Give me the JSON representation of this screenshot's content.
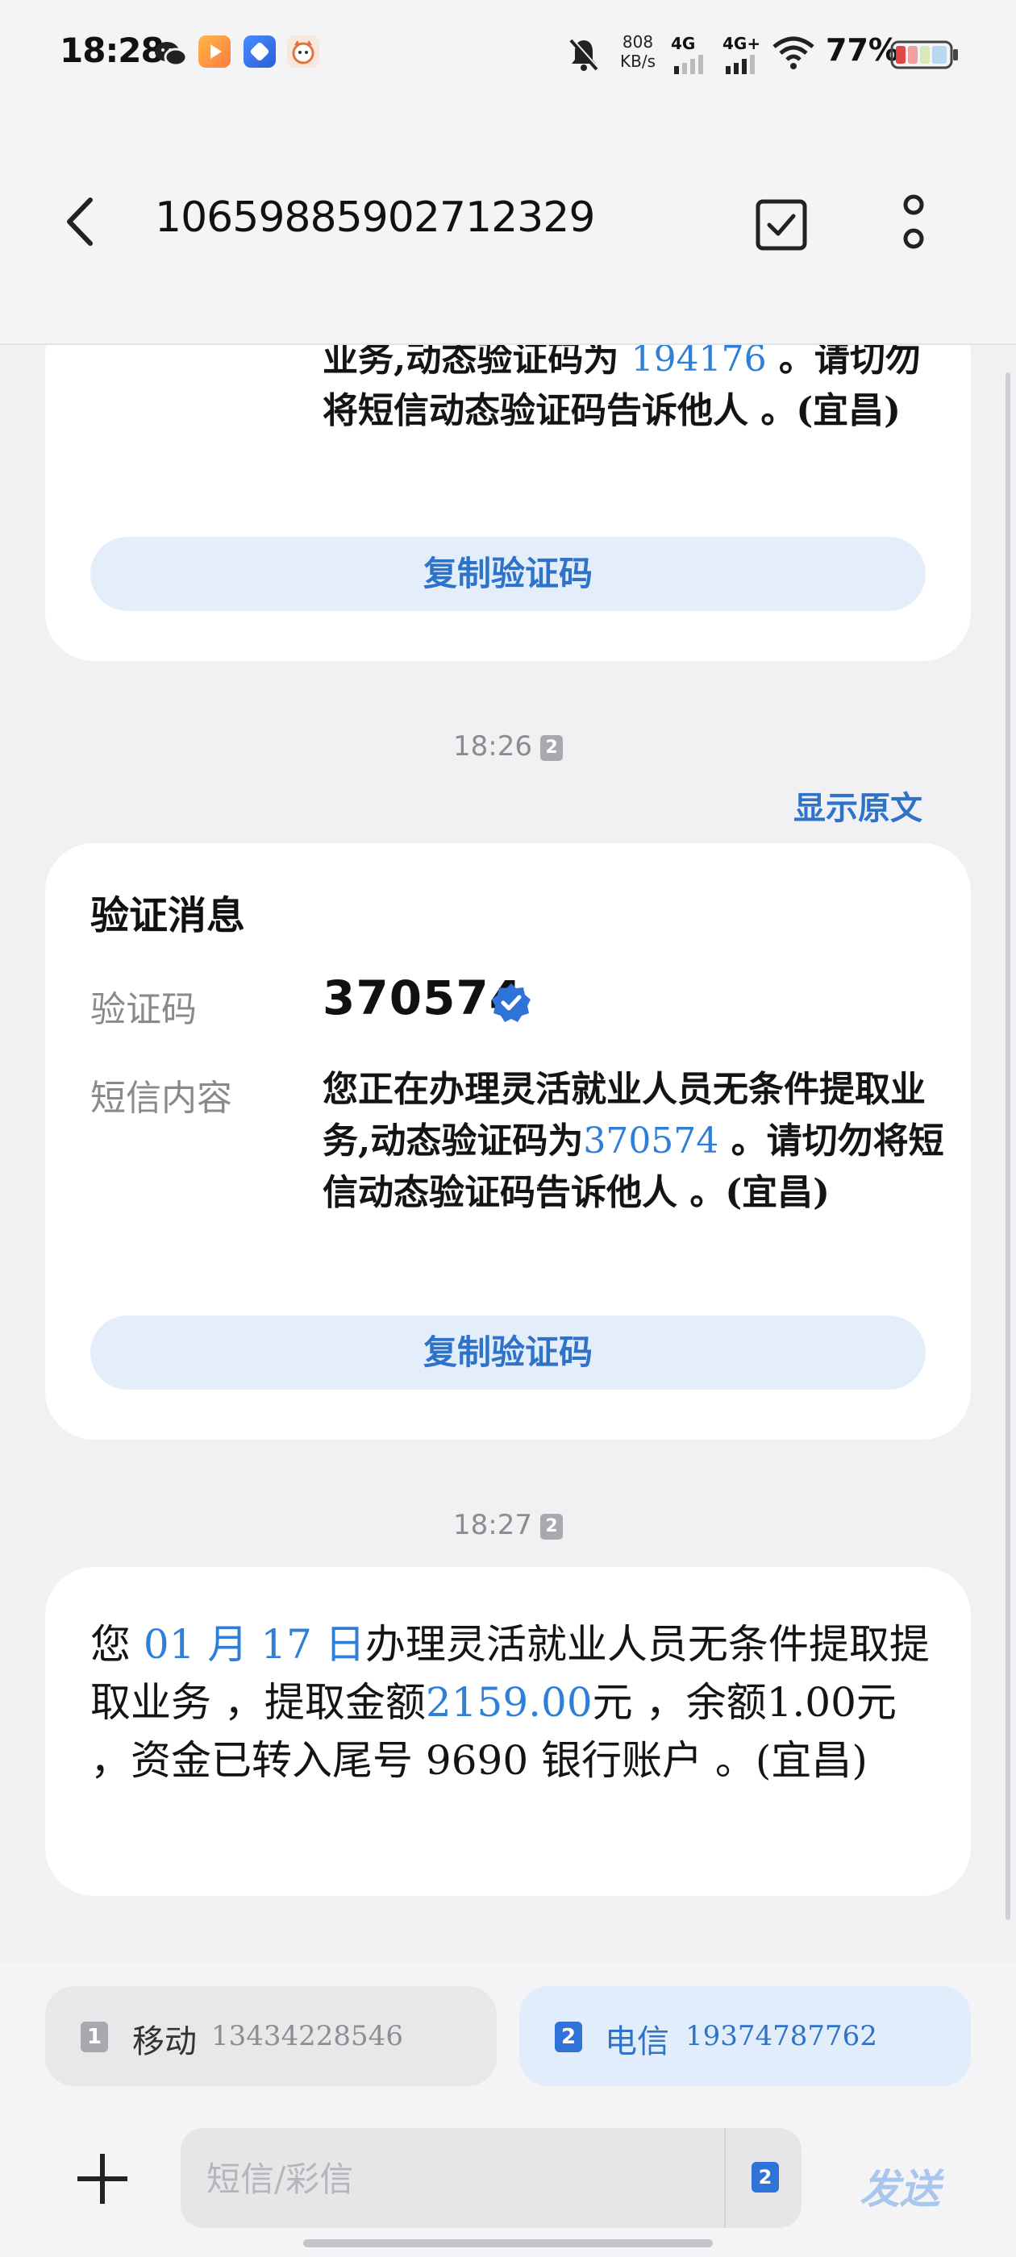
{
  "status_bar": {
    "time": "18:28",
    "network_speed_value": "808",
    "network_speed_unit": "KB/s",
    "sim1_type": "4G",
    "sim2_type": "4G+",
    "battery": "77%",
    "app_icons": [
      "wechat-icon",
      "video-app-icon",
      "blue-app-icon",
      "cat-app-icon"
    ]
  },
  "header": {
    "title": "10659885902712329"
  },
  "messages": {
    "first": {
      "text_before": "业务,动态验证码为 ",
      "code": "194176",
      "text_after": " 。请切勿将短信动态验证码告诉他人 。(宜昌)",
      "copy_label": "复制验证码"
    },
    "second": {
      "timestamp": "18:26",
      "sim": "2",
      "show_original": "显示原文",
      "card_title": "验证消息",
      "code_label": "验证码",
      "code": "370574",
      "content_label": "短信内容",
      "content_before": "您正在办理灵活就业人员无条件提取业务,动态验证码为",
      "content_code": "370574",
      "content_after": " 。请切勿将短信动态验证码告诉他人 。(宜昌)",
      "copy_label": "复制验证码"
    },
    "third": {
      "timestamp": "18:27",
      "sim": "2",
      "part1": "您 ",
      "date": "01 月 17 日",
      "part2": "办理灵活就业人员无条件提取提取业务 ，提取金额",
      "amount": "2159.00",
      "part3": "元 ，余额1.00元 ，资金已转入尾号 9690 银行账户 。(宜昌)"
    }
  },
  "sim_selector": {
    "sim1": {
      "num": "1",
      "name": "移动",
      "phone": "13434228546"
    },
    "sim2": {
      "num": "2",
      "name": "电信",
      "phone": "19374787762"
    }
  },
  "compose": {
    "placeholder": "短信/彩信",
    "sim_num": "2",
    "send_label": "发送"
  },
  "colors": {
    "accent": "#2f7fd8",
    "card_bg": "#ffffff",
    "page_bg": "#f1f1f3",
    "copy_button_bg": "#e4eefb",
    "verified_badge": "#2f73d9"
  }
}
